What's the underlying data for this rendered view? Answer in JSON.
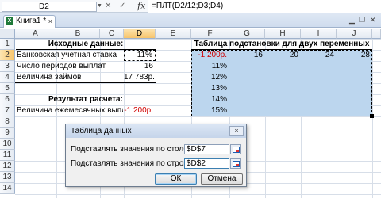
{
  "formula_bar": {
    "name_box": "D2",
    "fx_label": "fx",
    "formula": "=ПЛТ(D2/12;D3;D4)"
  },
  "workbook_tab": {
    "title": "Книга1 *",
    "close": "×"
  },
  "columns": [
    "A",
    "B",
    "C",
    "D",
    "E",
    "F",
    "G",
    "H",
    "I",
    "J"
  ],
  "rows": [
    "1",
    "2",
    "3",
    "4",
    "5",
    "6",
    "7",
    "8",
    "9",
    "10",
    "11",
    "12",
    "13",
    "14"
  ],
  "input_block": {
    "header": "Исходные данные:",
    "rows": [
      {
        "label": "Банковская учетная ставка",
        "value": "11%"
      },
      {
        "label": "Число периодов выплат",
        "value": "16"
      },
      {
        "label": "Величина займов",
        "value": "17 783р."
      }
    ],
    "result_header": "Результат расчета:",
    "result_label": "Величина ежемесячных выпл",
    "result_value": "-1 200р."
  },
  "data_table": {
    "title": "Таблица подстановки для двух переменных",
    "corner_value": "-1 200р.",
    "column_inputs": [
      "16",
      "20",
      "24",
      "28"
    ],
    "row_inputs": [
      "11%",
      "12%",
      "13%",
      "14%",
      "15%"
    ]
  },
  "dialog": {
    "title": "Таблица данных",
    "close": "×",
    "column_label": "Подставлять значения по столбцам в:",
    "column_value": "$D$7",
    "row_label": "Подставлять значения по строкам в:",
    "row_value": "$D$2",
    "ok": "ОК",
    "cancel": "Отмена"
  },
  "colors": {
    "table_fill": "#bcd6ee",
    "negative": "#d00000"
  }
}
